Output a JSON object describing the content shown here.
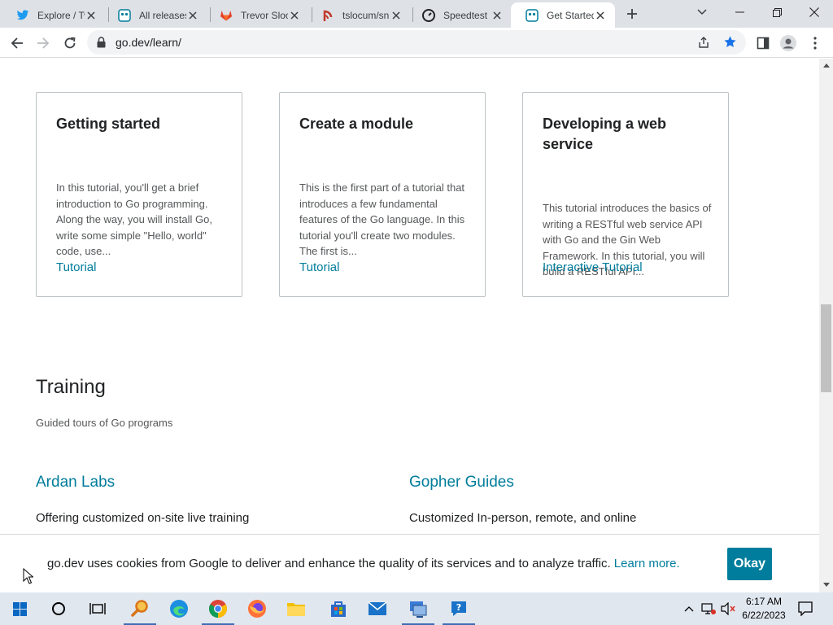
{
  "browser": {
    "tabs": [
      {
        "title": "Explore / Twitter",
        "icon": "twitter-icon"
      },
      {
        "title": "All releases",
        "icon": "go-gopher-icon"
      },
      {
        "title": "Trevor Slocum",
        "icon": "gitlab-icon"
      },
      {
        "title": "tslocum/sn",
        "icon": "feed-icon"
      },
      {
        "title": "Speedtest by Ookla",
        "icon": "speedtest-icon"
      },
      {
        "title": "Get Started",
        "icon": "go-gopher-icon"
      }
    ],
    "active_tab_index": 5,
    "url": "go.dev/learn/"
  },
  "cards": [
    {
      "title": "Getting started",
      "description": "In this tutorial, you'll get a brief introduction to Go programming. Along the way, you will install Go, write some simple \"Hello, world\" code, use...",
      "link": "Tutorial"
    },
    {
      "title": "Create a module",
      "description": "This is the first part of a tutorial that introduces a few fundamental features of the Go language. In this tutorial you'll create two modules. The first is...",
      "link": "Tutorial"
    },
    {
      "title": "Developing a web service",
      "description": "This tutorial introduces the basics of writing a RESTful web service API with Go and the Gin Web Framework. In this tutorial, you will build a RESTful API...",
      "link": "Interactive Tutorial"
    }
  ],
  "training": {
    "title": "Training",
    "subtitle": "Guided tours of Go programs",
    "orgs": [
      {
        "name": "Ardan Labs",
        "description": "Offering customized on-site live training"
      },
      {
        "name": "Gopher Guides",
        "description": "Customized In-person, remote, and online"
      }
    ]
  },
  "cookie_banner": {
    "text": "go.dev uses cookies from Google to deliver and enhance the quality of its services and to analyze traffic.",
    "link": "Learn more.",
    "button": "Okay"
  },
  "taskbar": {
    "time": "6:17 AM",
    "date": "6/22/2023"
  },
  "colors": {
    "link": "#007d9c",
    "button": "#007d9c",
    "tabstrip": "#dee1e6"
  }
}
